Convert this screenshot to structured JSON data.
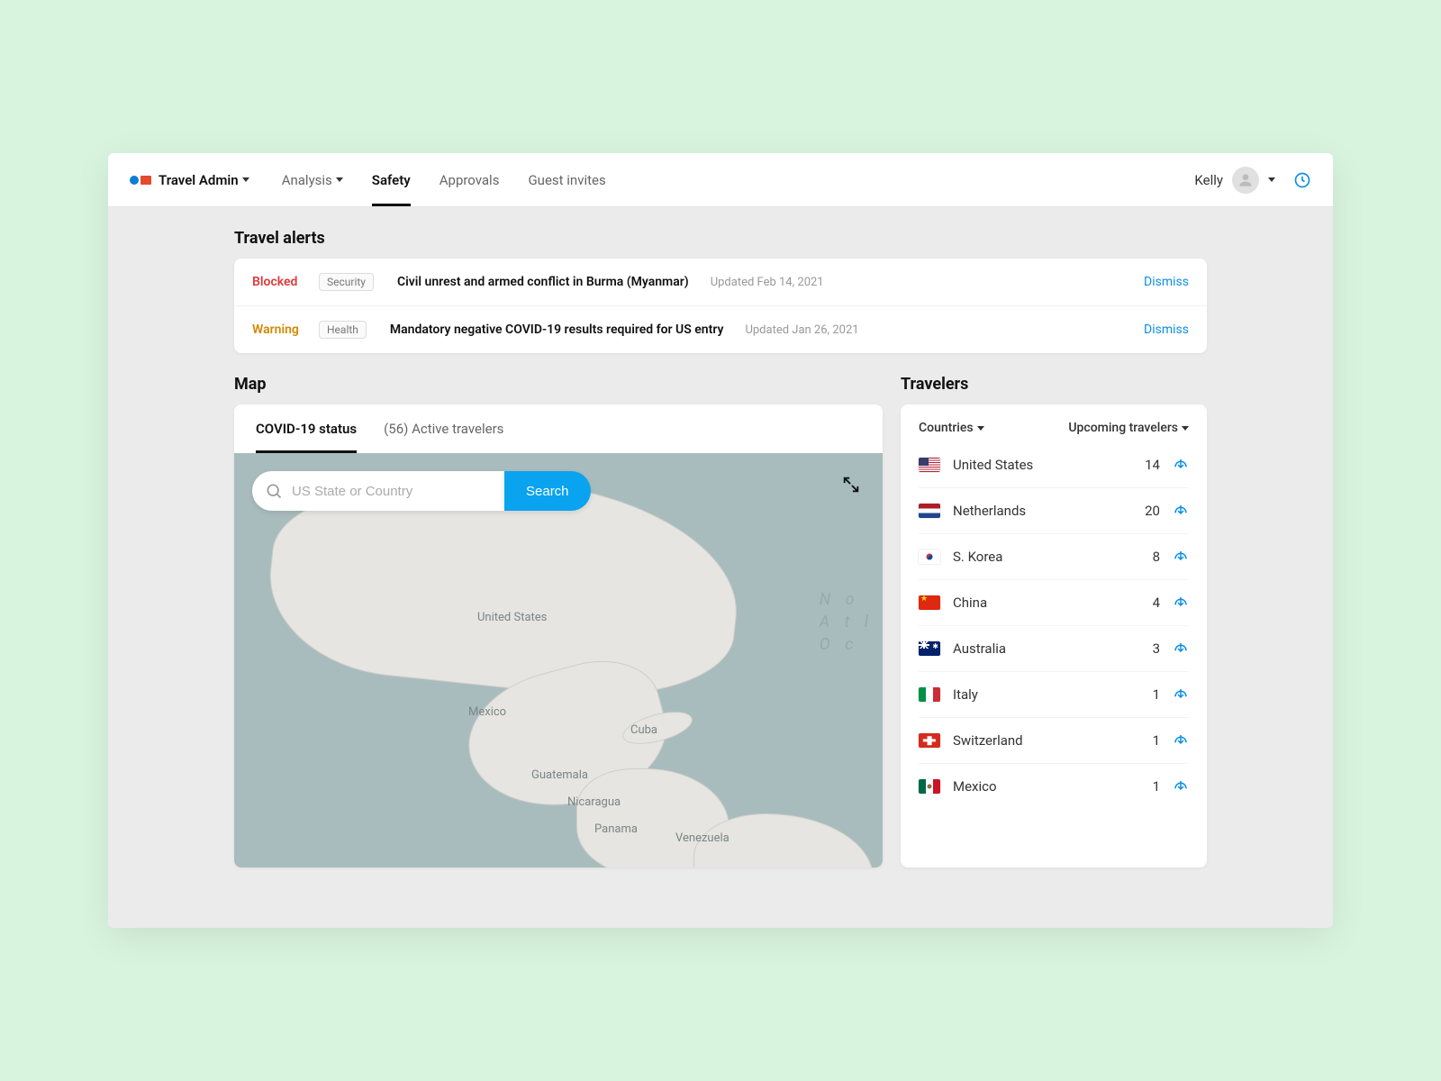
{
  "header": {
    "brand_title": "Travel Admin",
    "nav": [
      {
        "label": "Analysis",
        "has_dropdown": true,
        "active": false
      },
      {
        "label": "Safety",
        "has_dropdown": false,
        "active": true
      },
      {
        "label": "Approvals",
        "has_dropdown": false,
        "active": false
      },
      {
        "label": "Guest invites",
        "has_dropdown": false,
        "active": false
      }
    ],
    "user_name": "Kelly"
  },
  "alerts": {
    "title": "Travel alerts",
    "items": [
      {
        "level": "Blocked",
        "level_class": "blocked",
        "tag": "Security",
        "message": "Civil unrest and armed conflict in Burma (Myanmar)",
        "updated": "Updated Feb 14, 2021",
        "dismiss": "Dismiss"
      },
      {
        "level": "Warning",
        "level_class": "warning",
        "tag": "Health",
        "message": "Mandatory negative COVID-19 results required for US entry",
        "updated": "Updated Jan 26, 2021",
        "dismiss": "Dismiss"
      }
    ]
  },
  "map": {
    "title": "Map",
    "tabs": [
      {
        "label": "COVID-19 status",
        "active": true
      },
      {
        "label": "(56) Active travelers",
        "active": false
      }
    ],
    "search_placeholder": "US State or Country",
    "search_button": "Search",
    "labels": {
      "united_states": "United States",
      "mexico": "Mexico",
      "cuba": "Cuba",
      "guatemala": "Guatemala",
      "nicaragua": "Nicaragua",
      "panama": "Panama",
      "venezuela": "Venezuela",
      "ocean1": "N o",
      "ocean2": "A t l",
      "ocean3": "O c"
    }
  },
  "travelers": {
    "title": "Travelers",
    "filter_left": "Countries",
    "filter_right": "Upcoming travelers",
    "rows": [
      {
        "country": "United States",
        "count": "14",
        "flag": "flag-us"
      },
      {
        "country": "Netherlands",
        "count": "20",
        "flag": "flag-nl"
      },
      {
        "country": "S. Korea",
        "count": "8",
        "flag": "flag-kr"
      },
      {
        "country": "China",
        "count": "4",
        "flag": "flag-cn"
      },
      {
        "country": "Australia",
        "count": "3",
        "flag": "flag-au"
      },
      {
        "country": "Italy",
        "count": "1",
        "flag": "flag-it"
      },
      {
        "country": "Switzerland",
        "count": "1",
        "flag": "flag-ch"
      },
      {
        "country": "Mexico",
        "count": "1",
        "flag": "flag-mx"
      }
    ]
  }
}
